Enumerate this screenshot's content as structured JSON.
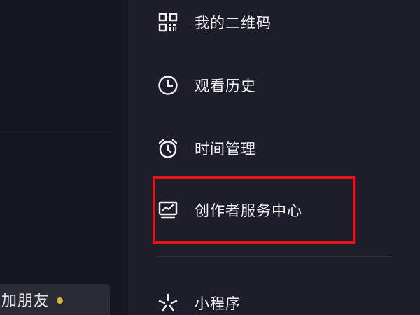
{
  "left_panel": {
    "add_friend_label": "加朋友"
  },
  "menu": {
    "items": [
      {
        "label": "我的二维码",
        "icon": "qr-code-icon"
      },
      {
        "label": "观看历史",
        "icon": "clock-icon"
      },
      {
        "label": "时间管理",
        "icon": "alarm-clock-icon"
      },
      {
        "label": "创作者服务中心",
        "icon": "creator-chart-icon"
      },
      {
        "label": "小程序",
        "icon": "mini-program-icon"
      }
    ]
  },
  "colors": {
    "background": "#161722",
    "drawer": "#1d1e29",
    "text": "#f2f2f5",
    "highlight": "#e0161a",
    "badge_dot": "#d6b33a"
  }
}
